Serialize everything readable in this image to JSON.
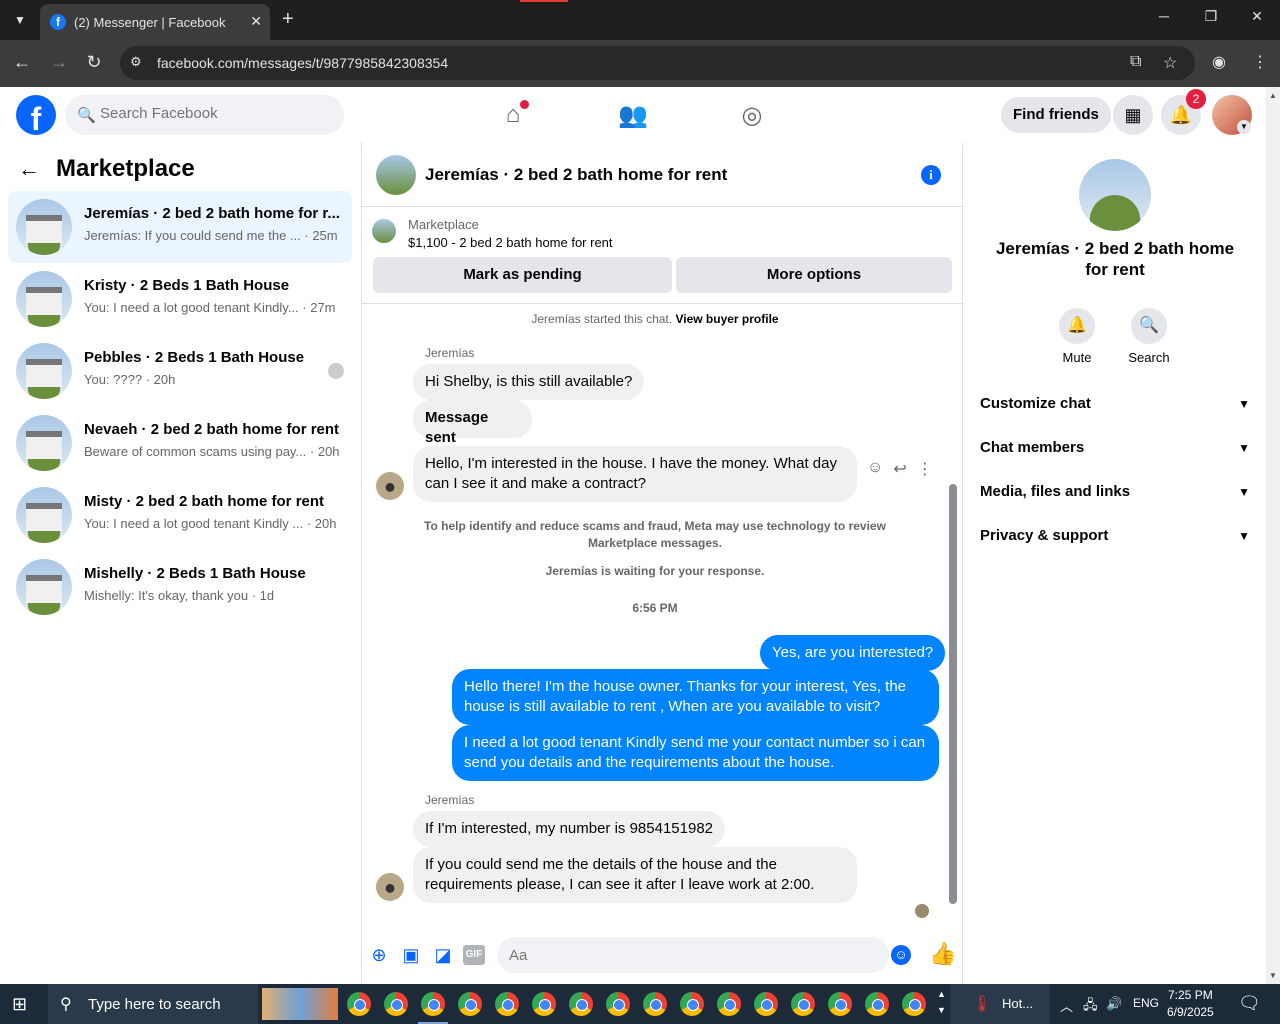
{
  "browser": {
    "tab_title": "(2) Messenger | Facebook",
    "url": "facebook.com/messages/t/9877985842308354"
  },
  "fb_header": {
    "logo_letter": "f",
    "search_placeholder": "Search Facebook",
    "find_friends_label": "Find friends",
    "notification_count": "2"
  },
  "left_panel": {
    "title": "Marketplace",
    "conversations": [
      {
        "title": "Jeremías · 2 bed 2 bath home for r...",
        "snippet": "Jeremías: If you could send me the ... · 25m",
        "active": true
      },
      {
        "title": "Kristy · 2 Beds 1 Bath House",
        "snippet": "You: I need a lot good tenant Kindly... · 27m"
      },
      {
        "title": "Pebbles · 2 Beds 1 Bath House",
        "snippet": "You: ???? · 20h"
      },
      {
        "title": "Nevaeh · 2 bed 2 bath home for rent",
        "snippet": "Beware of common scams using pay... · 20h"
      },
      {
        "title": "Misty · 2 bed 2 bath home for rent",
        "snippet": "You: I need a lot good tenant Kindly ... · 20h"
      },
      {
        "title": "Mishelly · 2 Beds 1 Bath House",
        "snippet": "Mishelly: It's okay, thank you · 1d"
      }
    ]
  },
  "chat": {
    "header_name": "Jeremías · 2 bed 2 bath home for rent",
    "listing_label": "Marketplace",
    "listing_price": "$1,100 - 2 bed 2 bath home for rent",
    "mark_pending_label": "Mark as pending",
    "more_options_label": "More options",
    "started_text": "Jeremías started this chat.",
    "view_profile_label": "View buyer profile",
    "sender_name": "Jeremías",
    "msg1": "Hi Shelby, is this still available?",
    "msg2": "Message sent",
    "msg3": "Hello, I'm interested in the house. I have the money. What day can I see it and make a contract?",
    "notice": "To help identify and reduce scams and fraud, Meta may use technology to review Marketplace messages.",
    "waiting": "Jeremías is waiting for your response.",
    "timestamp": "6:56 PM",
    "me1": "Yes, are you interested?",
    "me2": "Hello there! I'm the house owner. Thanks for your interest, Yes, the house is still available to rent , When are you available to visit?",
    "me3": "I need a lot good tenant Kindly send me your contact number so i can send you details and the requirements about the house.",
    "msg4": "If I'm interested, my number is 9854151982",
    "msg5": "If you could send me the details of the house and the requirements please, I can see it after I leave work at 2:00.",
    "composer_placeholder": "Aa",
    "gif_label": "GIF"
  },
  "right_panel": {
    "title": "Jeremías · 2 bed 2 bath home for rent",
    "mute_label": "Mute",
    "search_label": "Search",
    "sections": [
      "Customize chat",
      "Chat members",
      "Media, files and links",
      "Privacy & support"
    ]
  },
  "taskbar": {
    "search_placeholder": "Type here to search",
    "weather_label": "Hot...",
    "language": "ENG",
    "time": "7:25 PM",
    "date": "6/9/2025"
  }
}
